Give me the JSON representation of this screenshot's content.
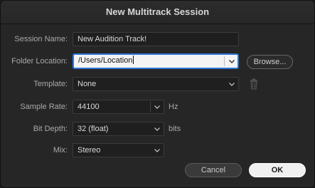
{
  "dialog": {
    "title": "New Multitrack Session"
  },
  "session_name": {
    "label": "Session Name:",
    "value": "New Audition Track!"
  },
  "folder_location": {
    "label": "Folder Location:",
    "value": "/Users/Location",
    "browse_label": "Browse..."
  },
  "template": {
    "label": "Template:",
    "value": "None"
  },
  "sample_rate": {
    "label": "Sample Rate:",
    "value": "44100",
    "unit": "Hz"
  },
  "bit_depth": {
    "label": "Bit Depth:",
    "value": "32 (float)",
    "unit": "bits"
  },
  "mix": {
    "label": "Mix:",
    "value": "Stereo"
  },
  "buttons": {
    "cancel": "Cancel",
    "ok": "OK"
  },
  "colors": {
    "focus_border": "#2d75d7",
    "background": "#262626"
  }
}
